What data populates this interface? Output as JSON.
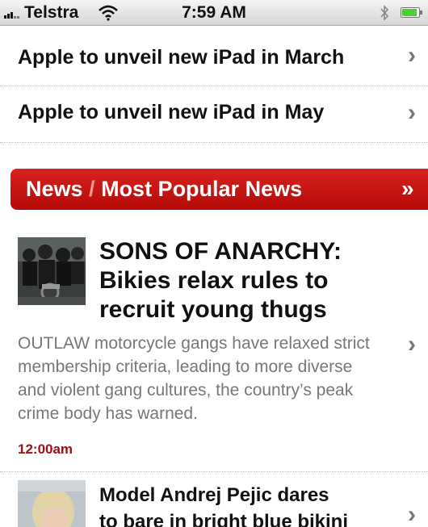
{
  "status_bar": {
    "carrier": "Telstra",
    "time": "7:59 AM",
    "bluetooth_icon": "bluetooth-icon",
    "battery_level": 0.9
  },
  "list": [
    {
      "title": "Apple to unveil new iPad in March"
    },
    {
      "title": "Apple to unveil new iPad in May"
    }
  ],
  "section": {
    "part1": "News",
    "separator": " / ",
    "part2": "Most Popular News",
    "chevron": "»"
  },
  "articles": [
    {
      "headline_lines": [
        "SONS OF ANARCHY:",
        "Bikies relax rules to",
        "recruit young thugs"
      ],
      "summary": "OUTLAW motorcycle gangs have relaxed strict membership criteria, leading to more diverse and violent gang cultures, the country’s peak crime body has warned.",
      "time": "12:00am"
    },
    {
      "headline_lines": [
        "Model Andrej Pejic dares",
        "to bare in bright blue bikini"
      ]
    }
  ],
  "colors": {
    "accent_red": "#c0120f",
    "time_red": "#a00f0f"
  }
}
